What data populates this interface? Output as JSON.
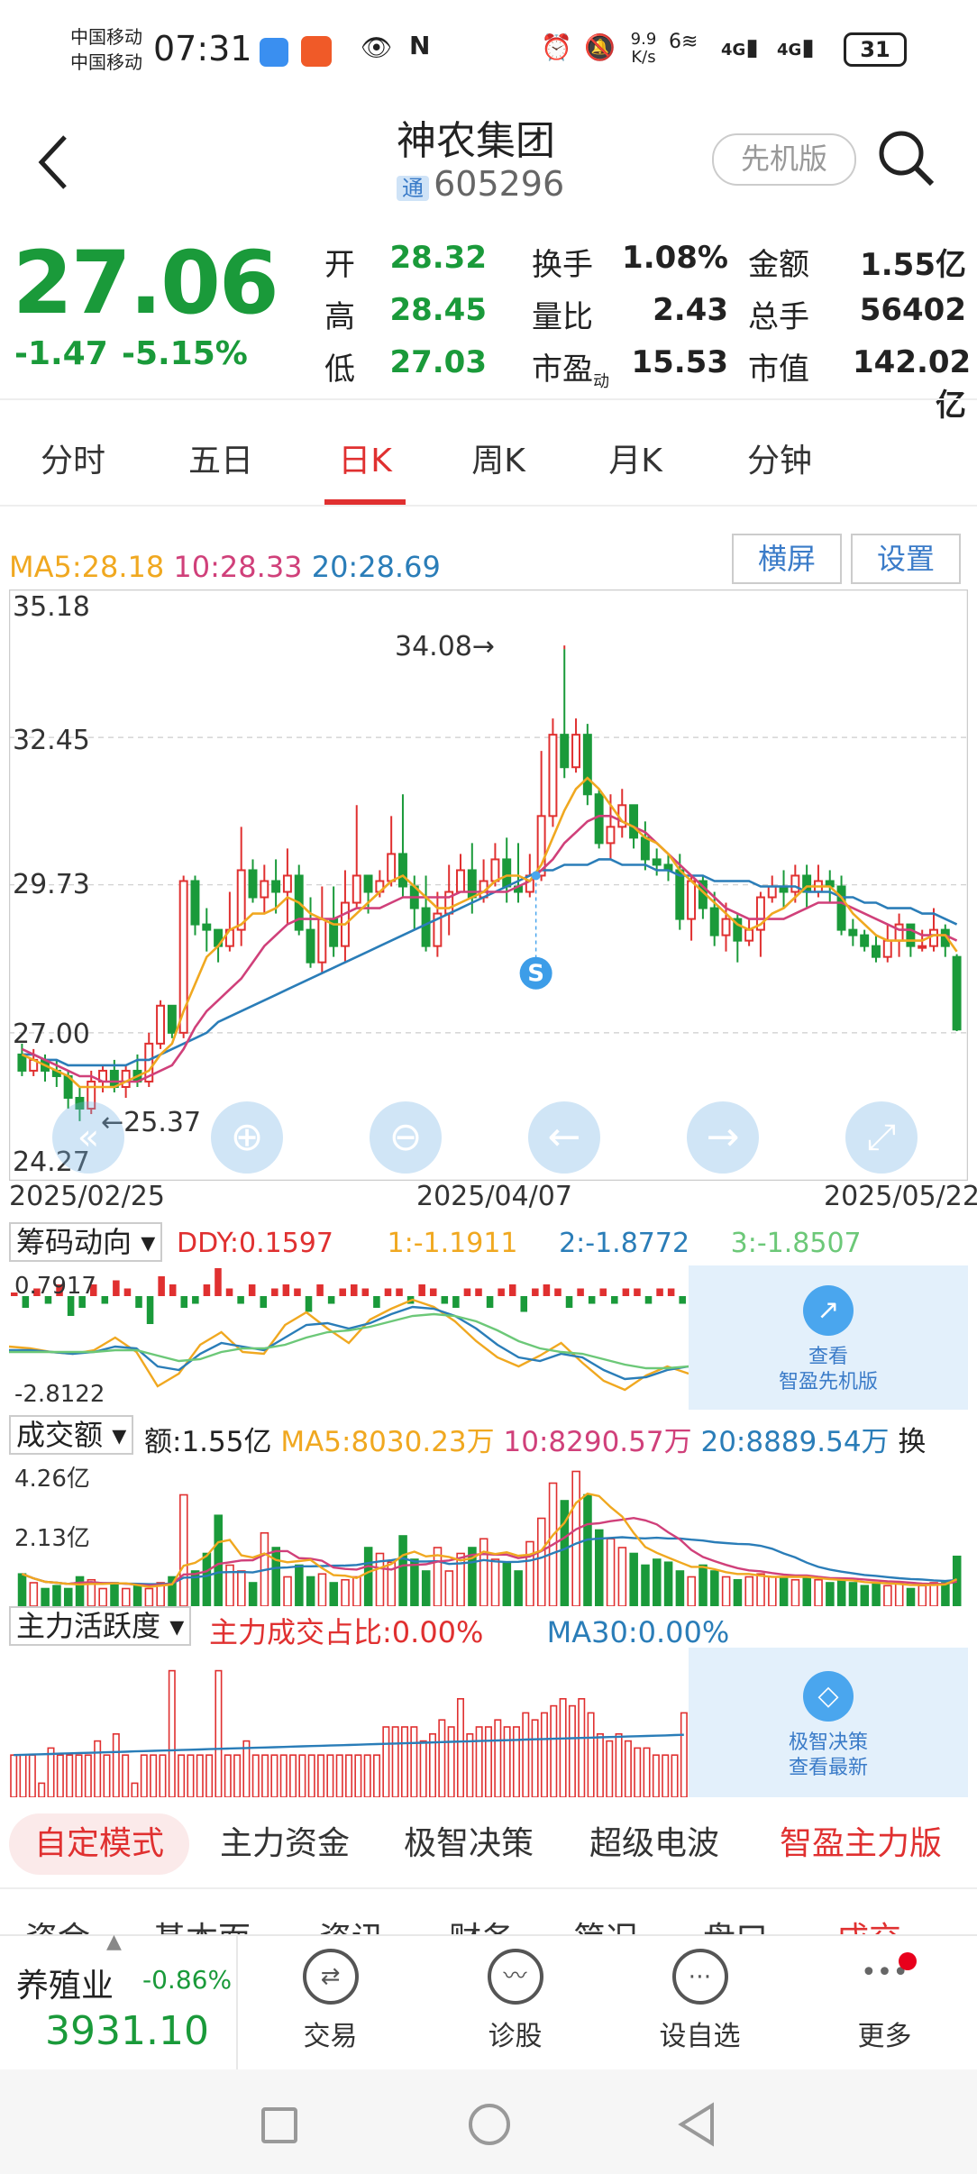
{
  "status_bar": {
    "carrier1": "中国移动",
    "carrier2": "中国移动",
    "time": "07:31",
    "net_speed_value": "9.9",
    "net_speed_unit": "K/s",
    "wifi_label": "6",
    "signal1": "4G",
    "signal2": "4G",
    "battery": "31"
  },
  "header": {
    "title": "神农集团",
    "tong": "通",
    "code": "605296",
    "pioneer_btn": "先机版",
    "back_icon": "chevron-left-icon",
    "search_icon": "search-icon"
  },
  "quote": {
    "price": "27.06",
    "change": "-1.47",
    "change_pct": "-5.15%",
    "rows": [
      [
        {
          "l": "开",
          "v": "28.32",
          "c": "g"
        },
        {
          "l": "换手",
          "v": "1.08%",
          "c": "k"
        },
        {
          "l": "金额",
          "v": "1.55亿",
          "c": "k"
        }
      ],
      [
        {
          "l": "高",
          "v": "28.45",
          "c": "g"
        },
        {
          "l": "量比",
          "v": "2.43",
          "c": "k"
        },
        {
          "l": "总手",
          "v": "56402",
          "c": "k"
        }
      ],
      [
        {
          "l": "低",
          "v": "27.03",
          "c": "g"
        },
        {
          "l": "市盈动",
          "v": "15.53",
          "c": "k"
        },
        {
          "l": "市值",
          "v": "142.02亿",
          "c": "k"
        }
      ]
    ]
  },
  "period_tabs": [
    "分时",
    "五日",
    "日K",
    "周K",
    "月K",
    "分钟"
  ],
  "active_period": 2,
  "chart_buttons": {
    "landscape": "横屏",
    "settings": "设置"
  },
  "ma_legend": {
    "ma5": "MA5:28.18",
    "ma10": "10:28.33",
    "ma20": "20:28.69",
    "colors": {
      "ma5": "#f0a820",
      "ma10": "#d0407a",
      "ma20": "#2a7db8",
      "up": "#e03030",
      "down": "#1a9a3a"
    }
  },
  "chart_data": {
    "type": "candlestick",
    "y_ticks": [
      "35.18",
      "32.45",
      "29.73",
      "27.00",
      "24.27"
    ],
    "ylim": [
      24.27,
      35.18
    ],
    "x_ticks": [
      "2025/02/25",
      "2025/04/07",
      "2025/05/22"
    ],
    "max_annotation": "34.08",
    "min_annotation": "25.37",
    "signal_marker": "S",
    "candles": [
      [
        26.6,
        26.3,
        26.8,
        26.2
      ],
      [
        26.3,
        26.5,
        26.7,
        26.2
      ],
      [
        26.5,
        26.3,
        26.6,
        26.1
      ],
      [
        26.3,
        26.2,
        26.5,
        26.0
      ],
      [
        26.2,
        25.8,
        26.3,
        25.6
      ],
      [
        25.8,
        25.6,
        26.0,
        25.37
      ],
      [
        25.6,
        26.1,
        26.3,
        25.5
      ],
      [
        26.1,
        26.3,
        26.4,
        25.9
      ],
      [
        26.3,
        26.0,
        26.5,
        25.9
      ],
      [
        26.0,
        26.3,
        26.4,
        25.8
      ],
      [
        26.3,
        26.1,
        26.6,
        26.0
      ],
      [
        26.1,
        26.8,
        27.0,
        26.0
      ],
      [
        26.8,
        27.5,
        27.6,
        26.7
      ],
      [
        27.5,
        27.0,
        27.3,
        26.9
      ],
      [
        27.0,
        29.8,
        29.9,
        26.9
      ],
      [
        29.8,
        29.0,
        29.9,
        28.8
      ],
      [
        29.0,
        28.9,
        29.3,
        28.5
      ],
      [
        28.9,
        28.6,
        28.9,
        28.3
      ],
      [
        28.6,
        28.9,
        29.6,
        28.5
      ],
      [
        28.9,
        30.0,
        30.8,
        28.6
      ],
      [
        30.0,
        29.5,
        30.2,
        29.4
      ],
      [
        29.5,
        29.8,
        30.1,
        29.2
      ],
      [
        29.8,
        29.6,
        30.2,
        29.2
      ],
      [
        29.6,
        29.9,
        30.4,
        29.0
      ],
      [
        29.9,
        28.9,
        30.1,
        28.8
      ],
      [
        28.9,
        28.3,
        29.5,
        28.2
      ],
      [
        28.3,
        29.1,
        29.7,
        28.1
      ],
      [
        29.1,
        28.6,
        29.7,
        28.4
      ],
      [
        28.6,
        29.4,
        30.0,
        28.3
      ],
      [
        29.4,
        29.9,
        31.2,
        29.3
      ],
      [
        29.9,
        29.6,
        29.9,
        29.2
      ],
      [
        29.6,
        29.8,
        30.0,
        29.5
      ],
      [
        29.8,
        30.3,
        31.0,
        29.7
      ],
      [
        30.3,
        29.7,
        31.4,
        29.5
      ],
      [
        29.7,
        29.3,
        29.9,
        28.9
      ],
      [
        29.3,
        28.6,
        29.9,
        28.5
      ],
      [
        28.6,
        29.2,
        29.6,
        28.4
      ],
      [
        29.2,
        29.6,
        30.1,
        28.8
      ],
      [
        29.6,
        30.0,
        30.3,
        29.6
      ],
      [
        30.0,
        29.5,
        30.5,
        29.2
      ],
      [
        29.5,
        29.8,
        30.2,
        29.4
      ],
      [
        29.8,
        30.2,
        30.5,
        29.7
      ],
      [
        30.2,
        29.7,
        30.6,
        29.4
      ],
      [
        29.7,
        29.6,
        30.5,
        29.4
      ],
      [
        29.6,
        29.9,
        30.3,
        29.5
      ],
      [
        29.9,
        31.0,
        32.2,
        29.8
      ],
      [
        31.0,
        32.5,
        32.8,
        30.8
      ],
      [
        32.5,
        31.9,
        34.08,
        31.7
      ],
      [
        31.9,
        32.5,
        32.8,
        31.8
      ],
      [
        32.5,
        31.4,
        32.7,
        31.2
      ],
      [
        31.4,
        30.5,
        31.5,
        30.4
      ],
      [
        30.5,
        30.8,
        31.4,
        30.2
      ],
      [
        30.8,
        31.2,
        31.5,
        30.6
      ],
      [
        31.2,
        30.6,
        31.2,
        30.4
      ],
      [
        30.6,
        30.2,
        30.9,
        30.0
      ],
      [
        30.2,
        30.1,
        30.4,
        29.9
      ],
      [
        30.1,
        30.0,
        30.3,
        29.8
      ],
      [
        30.0,
        29.1,
        30.3,
        28.9
      ],
      [
        29.1,
        29.8,
        29.9,
        28.7
      ],
      [
        29.8,
        29.3,
        29.9,
        29.1
      ],
      [
        29.3,
        28.8,
        29.6,
        28.6
      ],
      [
        28.8,
        29.1,
        29.4,
        28.5
      ],
      [
        29.1,
        28.7,
        29.2,
        28.3
      ],
      [
        28.7,
        28.9,
        29.1,
        28.6
      ],
      [
        28.9,
        29.5,
        29.6,
        28.4
      ],
      [
        29.5,
        29.7,
        29.9,
        29.4
      ],
      [
        29.7,
        29.6,
        30.0,
        29.3
      ],
      [
        29.6,
        29.9,
        30.1,
        29.4
      ],
      [
        29.9,
        29.6,
        30.1,
        29.3
      ],
      [
        29.6,
        29.8,
        30.1,
        29.5
      ],
      [
        29.8,
        29.7,
        30.0,
        29.4
      ],
      [
        29.7,
        28.9,
        29.9,
        28.8
      ],
      [
        28.9,
        28.8,
        29.1,
        28.6
      ],
      [
        28.8,
        28.6,
        28.9,
        28.5
      ],
      [
        28.6,
        28.4,
        28.8,
        28.3
      ],
      [
        28.4,
        28.7,
        29.0,
        28.3
      ],
      [
        28.7,
        29.0,
        29.2,
        28.4
      ],
      [
        29.0,
        28.6,
        29.0,
        28.4
      ],
      [
        28.6,
        28.6,
        28.9,
        28.5
      ],
      [
        28.6,
        28.9,
        29.3,
        28.5
      ],
      [
        28.9,
        28.6,
        29.0,
        28.4
      ],
      [
        28.4,
        27.06,
        28.45,
        27.03
      ]
    ],
    "ma5": [
      26.6,
      26.5,
      26.4,
      26.3,
      26.2,
      26.0,
      26.0,
      26.0,
      26.0,
      26.1,
      26.2,
      26.3,
      26.6,
      26.8,
      27.4,
      27.9,
      28.4,
      28.6,
      28.9,
      29.0,
      29.2,
      29.2,
      29.3,
      29.5,
      29.4,
      29.2,
      29.1,
      29.0,
      29.0,
      29.2,
      29.4,
      29.6,
      29.8,
      29.9,
      29.7,
      29.5,
      29.3,
      29.3,
      29.4,
      29.5,
      29.6,
      29.8,
      29.9,
      29.9,
      29.8,
      30.1,
      30.6,
      31.1,
      31.5,
      31.7,
      31.5,
      31.2,
      30.9,
      30.8,
      30.6,
      30.5,
      30.3,
      30.0,
      29.8,
      29.6,
      29.4,
      29.2,
      29.0,
      28.9,
      29.0,
      29.2,
      29.3,
      29.5,
      29.7,
      29.7,
      29.7,
      29.5,
      29.2,
      29.0,
      28.8,
      28.7,
      28.7,
      28.7,
      28.7,
      28.8,
      28.8,
      28.5
    ],
    "ma10": [
      26.7,
      26.6,
      26.5,
      26.4,
      26.3,
      26.2,
      26.2,
      26.1,
      26.1,
      26.1,
      26.1,
      26.2,
      26.3,
      26.4,
      26.7,
      27.1,
      27.4,
      27.6,
      27.8,
      28.0,
      28.3,
      28.6,
      28.8,
      29.0,
      29.1,
      29.1,
      29.1,
      29.1,
      29.2,
      29.3,
      29.3,
      29.3,
      29.4,
      29.5,
      29.5,
      29.5,
      29.5,
      29.5,
      29.6,
      29.6,
      29.6,
      29.6,
      29.6,
      29.7,
      29.8,
      30.0,
      30.2,
      30.5,
      30.7,
      30.9,
      31.0,
      31.0,
      30.9,
      30.8,
      30.7,
      30.5,
      30.3,
      30.1,
      29.9,
      29.7,
      29.5,
      29.3,
      29.2,
      29.1,
      29.1,
      29.1,
      29.1,
      29.2,
      29.3,
      29.4,
      29.4,
      29.4,
      29.3,
      29.2,
      29.1,
      29.0,
      28.9,
      28.9,
      28.8,
      28.8,
      28.8,
      28.7
    ],
    "ma20": [
      26.6,
      26.6,
      26.5,
      26.5,
      26.4,
      26.4,
      26.4,
      26.4,
      26.4,
      26.4,
      26.5,
      26.5,
      26.6,
      26.7,
      26.8,
      26.9,
      27.0,
      27.2,
      27.3,
      27.4,
      27.5,
      27.6,
      27.7,
      27.8,
      27.9,
      28.0,
      28.1,
      28.2,
      28.3,
      28.4,
      28.5,
      28.6,
      28.7,
      28.8,
      28.9,
      29.0,
      29.1,
      29.2,
      29.3,
      29.4,
      29.5,
      29.6,
      29.7,
      29.8,
      29.9,
      30.0,
      30.0,
      30.1,
      30.1,
      30.1,
      30.2,
      30.2,
      30.1,
      30.1,
      30.1,
      30.0,
      30.0,
      29.9,
      29.9,
      29.9,
      29.8,
      29.8,
      29.8,
      29.8,
      29.7,
      29.7,
      29.7,
      29.7,
      29.6,
      29.6,
      29.6,
      29.5,
      29.5,
      29.4,
      29.4,
      29.3,
      29.3,
      29.3,
      29.2,
      29.2,
      29.1,
      29.0
    ]
  },
  "chip_panel": {
    "selector": "筹码动向",
    "ddy": "DDY:0.1597",
    "l1": "1:-1.1911",
    "l2": "2:-1.8772",
    "l3": "3:-1.8507",
    "top": "0.7917",
    "bottom": "-2.8122",
    "ad_line1": "查看",
    "ad_line2": "智盈先机版",
    "ad_icon": "chart-up-icon"
  },
  "volume_panel": {
    "selector": "成交额",
    "amount": "额:1.55亿",
    "ma5": "MA5:8030.23万",
    "ma10": "10:8290.57万",
    "ma20": "20:8889.54万",
    "extra": "换",
    "top": "4.26亿",
    "mid": "2.13亿",
    "bars": [
      0.55,
      0.4,
      0.3,
      0.35,
      0.3,
      0.5,
      0.45,
      0.3,
      0.4,
      0.3,
      0.35,
      0.3,
      0.4,
      0.5,
      1.9,
      0.6,
      0.9,
      1.55,
      0.7,
      0.6,
      0.4,
      1.25,
      1.0,
      0.5,
      0.7,
      0.5,
      0.55,
      0.4,
      0.45,
      0.5,
      1.0,
      0.9,
      0.75,
      1.2,
      0.8,
      0.6,
      1.0,
      0.6,
      0.9,
      1.0,
      1.15,
      0.8,
      0.75,
      0.6,
      1.1,
      1.5,
      2.1,
      1.8,
      2.3,
      1.9,
      1.3,
      1.15,
      1.0,
      0.9,
      0.7,
      0.8,
      0.75,
      0.6,
      0.5,
      0.7,
      0.6,
      0.5,
      0.45,
      0.5,
      0.55,
      0.5,
      0.5,
      0.45,
      0.5,
      0.45,
      0.4,
      0.45,
      0.4,
      0.35,
      0.4,
      0.35,
      0.4,
      0.3,
      0.35,
      0.4,
      0.4,
      0.85
    ]
  },
  "main_force_panel": {
    "selector": "主力活跃度",
    "ratio": "主力成交占比:0.00%",
    "ma30": "MA30:0.00%",
    "ad_line1": "极智决策",
    "ad_line2": "查看最新",
    "ad_icon": "cube-icon",
    "bars": [
      0.3,
      0.3,
      0.3,
      0.1,
      0.35,
      0.3,
      0.3,
      0.3,
      0.3,
      0.4,
      0.3,
      0.45,
      0.3,
      0.1,
      0.3,
      0.3,
      0.3,
      0.9,
      0.3,
      0.3,
      0.3,
      0.3,
      0.9,
      0.3,
      0.3,
      0.4,
      0.3,
      0.3,
      0.3,
      0.3,
      0.3,
      0.3,
      0.3,
      0.3,
      0.3,
      0.3,
      0.3,
      0.3,
      0.3,
      0.3,
      0.5,
      0.5,
      0.5,
      0.5,
      0.4,
      0.45,
      0.55,
      0.5,
      0.7,
      0.45,
      0.5,
      0.5,
      0.55,
      0.5,
      0.5,
      0.6,
      0.55,
      0.6,
      0.65,
      0.7,
      0.65,
      0.7,
      0.6,
      0.45,
      0.4,
      0.45,
      0.4,
      0.35,
      0.35,
      0.3,
      0.3,
      0.3,
      0.6
    ]
  },
  "mode_tabs": [
    "自定模式",
    "主力资金",
    "极智决策",
    "超级电波",
    "智盈主力版"
  ],
  "sub_tabs": [
    "资金",
    "基本面",
    "资讯",
    "财务",
    "简况",
    "盘口",
    "成交"
  ],
  "index_ticker": {
    "name": "养殖业",
    "pct": "-0.86%",
    "value": "3931.10"
  },
  "bottom_nav": [
    {
      "label": "交易",
      "icon": "exchange-icon",
      "glyph": "⇄"
    },
    {
      "label": "诊股",
      "icon": "diagnosis-icon",
      "glyph": "〰"
    },
    {
      "label": "设自选",
      "icon": "add-watchlist-icon",
      "glyph": "⋯"
    },
    {
      "label": "更多",
      "icon": "more-icon",
      "glyph": "•••"
    }
  ]
}
